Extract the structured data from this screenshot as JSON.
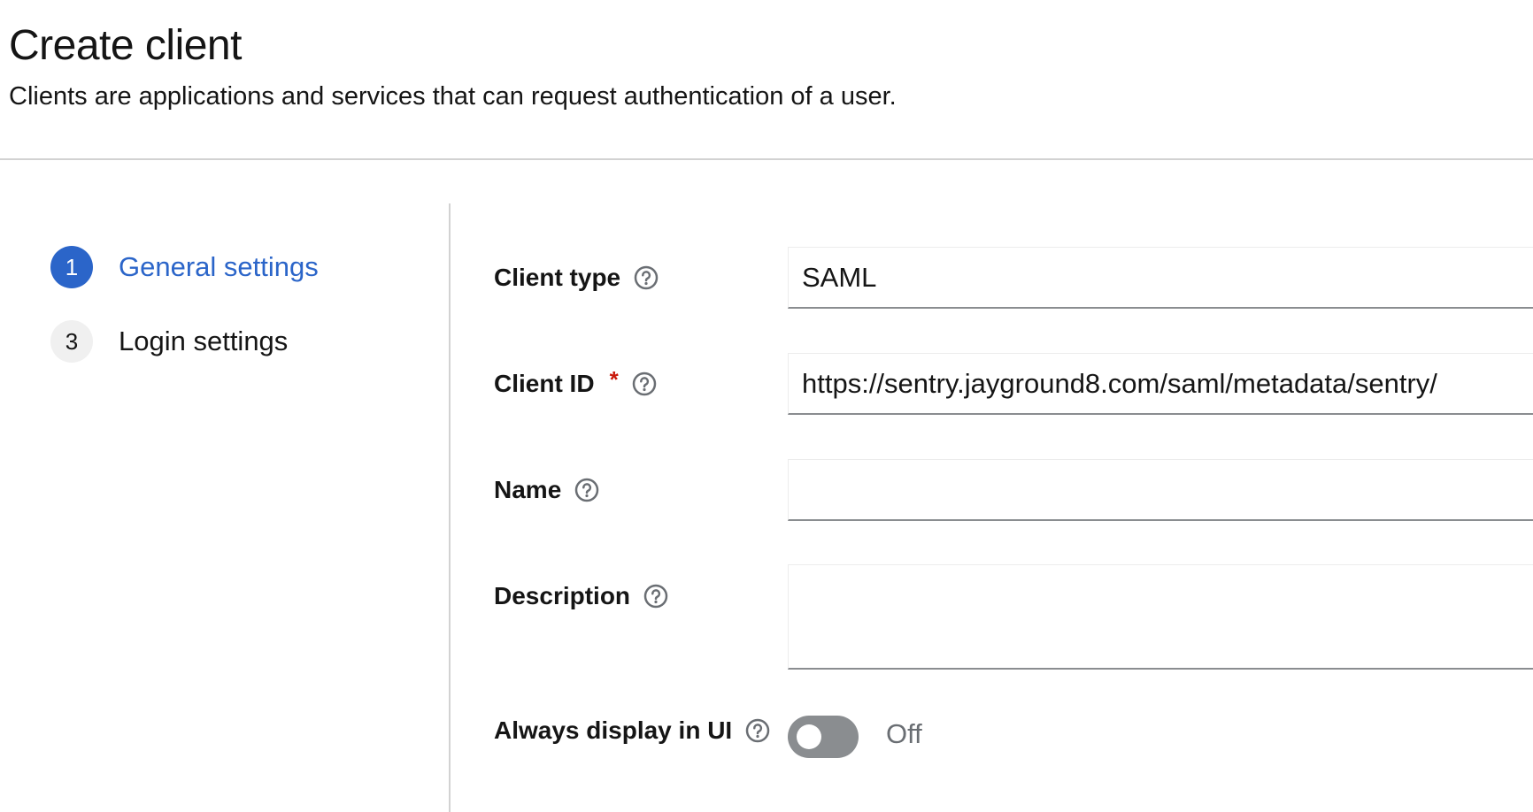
{
  "header": {
    "title": "Create client",
    "subtitle": "Clients are applications and services that can request authentication of a user."
  },
  "wizard": {
    "steps": [
      {
        "number": "1",
        "label": "General settings",
        "state": "current"
      },
      {
        "number": "3",
        "label": "Login settings",
        "state": "pending"
      }
    ]
  },
  "form": {
    "client_type": {
      "label": "Client type",
      "value": "SAML"
    },
    "client_id": {
      "label": "Client ID",
      "required_marker": "*",
      "value": "https://sentry.jayground8.com/saml/metadata/sentry/"
    },
    "name": {
      "label": "Name",
      "value": ""
    },
    "description": {
      "label": "Description",
      "value": ""
    },
    "always_display": {
      "label": "Always display in UI",
      "state_text": "Off",
      "checked": false
    }
  },
  "colors": {
    "accent": "#2b65c9",
    "required": "#c9190b",
    "switch_off": "#8a8d90",
    "divider": "#d2d2d2"
  },
  "icons": {
    "help": "question-circle-icon"
  }
}
